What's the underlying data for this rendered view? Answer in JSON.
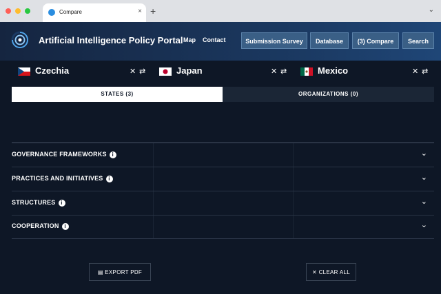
{
  "browser": {
    "tab_title": "Compare",
    "tab_close": "×",
    "new_tab": "+",
    "menu_chevron": "⌄",
    "traffic_lights": [
      "#ff5f57",
      "#febc2e",
      "#28c840"
    ]
  },
  "header": {
    "brand": "Artificial Intelligence Policy Portal",
    "nav": [
      "Map",
      "Contact"
    ],
    "buttons": [
      "Submission Survey",
      "Database",
      "(3) Compare",
      "Search"
    ],
    "accent": "#3a5f86"
  },
  "tabs": {
    "states": "STATES (3)",
    "organizations": "ORGANIZATIONS (0)"
  },
  "countries": [
    {
      "name": "Czechia",
      "flag": "flag-czechia-icon"
    },
    {
      "name": "Japan",
      "flag": "flag-japan-icon"
    },
    {
      "name": "Mexico",
      "flag": "flag-mexico-icon"
    }
  ],
  "country_actions": {
    "remove": "✕",
    "swap": "⇄"
  },
  "sections": [
    {
      "title": "GOVERNANCE FRAMEWORKS"
    },
    {
      "title": "PRACTICES AND INITIATIVES"
    },
    {
      "title": "STRUCTURES"
    },
    {
      "title": "COOPERATION"
    }
  ],
  "info_glyph": "i",
  "section_chevron": "⌄",
  "footer": {
    "export_label": "EXPORT PDF",
    "clear_label": "CLEAR ALL"
  }
}
